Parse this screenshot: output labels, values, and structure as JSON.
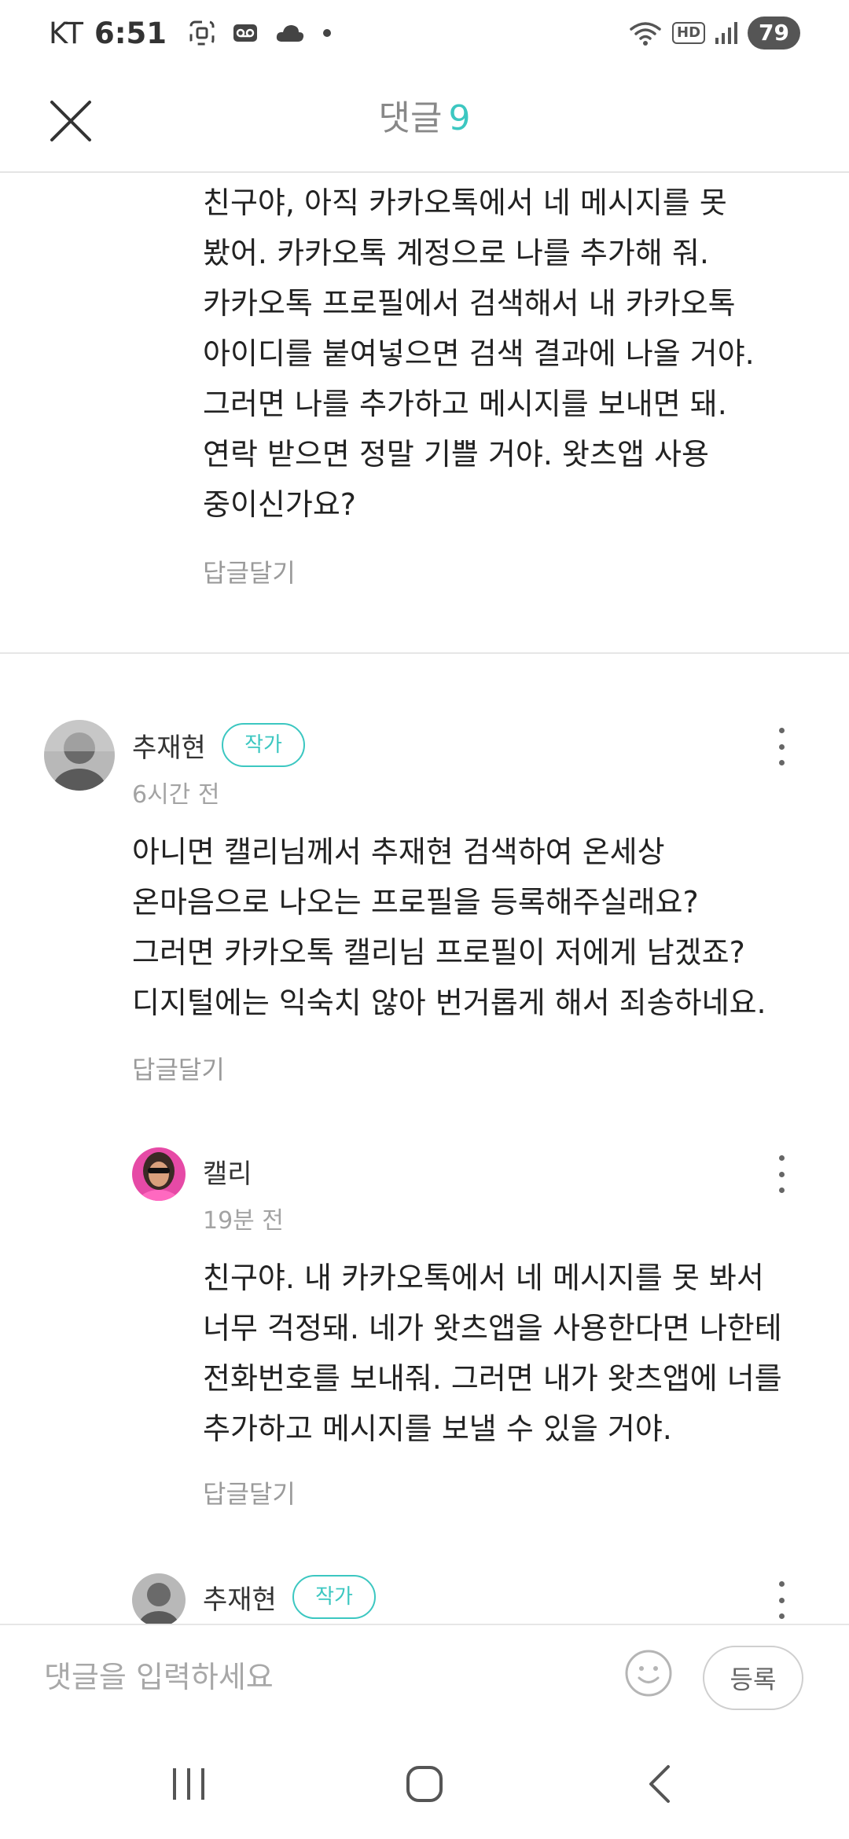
{
  "status_bar": {
    "carrier": "KT",
    "time": "6:51",
    "hd_label": "HD",
    "battery": "79"
  },
  "header": {
    "title": "댓글",
    "count": "9"
  },
  "comments": [
    {
      "lines": [
        "친구야, 아직 카카오톡에서 네 메시지를 못",
        "봤어. 카카오톡 계정으로 나를 추가해 줘.",
        "카카오톡 프로필에서 검색해서 내 카카오톡",
        "아이디를 붙여넣으면 검색 결과에 나올 거야.",
        "그러면 나를 추가하고 메시지를 보내면 돼.",
        "연락 받으면 정말 기쁠 거야. 왓츠앱 사용",
        "중이신가요?"
      ],
      "reply_label": "답글달기"
    },
    {
      "author": "추재현",
      "badge": "작가",
      "time": "6시간 전",
      "lines": [
        "아니면 캘리님께서 추재현 검색하여 온세상",
        "온마음으로 나오는 프로필을 등록해주실래요?",
        "그러면 카카오톡 캘리님 프로필이 저에게 남겠죠?",
        "디지털에는 익숙치 않아 번거롭게 해서 죄송하네요."
      ],
      "reply_label": "답글달기"
    },
    {
      "author": "캘리",
      "time": "19분 전",
      "lines": [
        "친구야. 내 카카오톡에서 네 메시지를 못 봐서",
        "너무 걱정돼. 네가 왓츠앱을 사용한다면 나한테",
        "전화번호를 보내줘. 그러면 내가 왓츠앱에 너를",
        "추가하고 메시지를 보낼 수 있을 거야."
      ],
      "reply_label": "답글달기"
    },
    {
      "author": "추재현",
      "badge": "작가"
    }
  ],
  "input": {
    "placeholder": "댓글을 입력하세요",
    "submit_label": "등록"
  },
  "colors": {
    "accent": "#3cc7c1",
    "muted_text": "#9a9a9a"
  }
}
